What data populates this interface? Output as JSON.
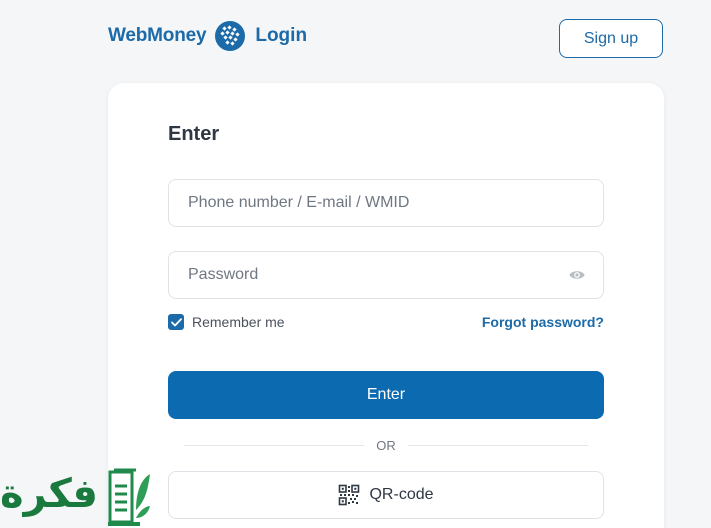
{
  "header": {
    "brand_name": "WebMoney",
    "brand_login": "Login",
    "signup_label": "Sign up"
  },
  "form": {
    "title": "Enter",
    "login_placeholder": "Phone number / E-mail / WMID",
    "login_value": "",
    "password_placeholder": "Password",
    "password_value": "",
    "remember_label": "Remember me",
    "remember_checked": true,
    "forgot_label": "Forgot password?",
    "enter_label": "Enter",
    "divider_label": "OR",
    "qr_label": "QR-code"
  },
  "icons": {
    "brand": "webmoney-globe-icon",
    "password_toggle": "eye-icon",
    "checkbox": "checkmark-icon",
    "qr": "qr-code-icon"
  },
  "colors": {
    "accent": "#1c6aa8",
    "primary_button": "#0b6ab0",
    "background": "#f5f6f8"
  },
  "watermark": {
    "text": "فكرة"
  }
}
